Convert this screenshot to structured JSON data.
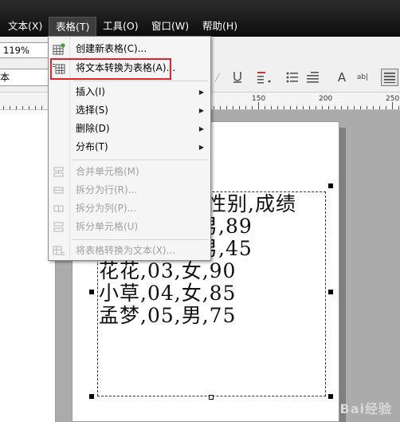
{
  "menubar": {
    "items": [
      {
        "label": "文本(X)"
      },
      {
        "label": "表格(T)"
      },
      {
        "label": "工具(O)"
      },
      {
        "label": "窗口(W)"
      },
      {
        "label": "帮助(H)"
      }
    ]
  },
  "toolbar": {
    "zoom_value": "119%",
    "font_value": "本",
    "icons": [
      "underline-icon",
      "bullets-icon",
      "list-icon",
      "align-icon",
      "text-icon",
      "font-icon",
      "paragraph-icon"
    ]
  },
  "ruler": {
    "labels": [
      "150",
      "200",
      "250"
    ]
  },
  "table_menu": {
    "items": [
      {
        "label": "创建新表格(C)...",
        "icon": "table-new-icon",
        "enabled": true
      },
      {
        "label": "将文本转换为表格(A)...",
        "icon": "table-convert-icon",
        "enabled": true
      },
      {
        "label": "插入(I)",
        "submenu": true,
        "enabled": true
      },
      {
        "label": "选择(S)",
        "submenu": true,
        "enabled": true
      },
      {
        "label": "删除(D)",
        "submenu": true,
        "enabled": true
      },
      {
        "label": "分布(T)",
        "submenu": true,
        "enabled": true
      },
      {
        "label": "合并单元格(M)",
        "enabled": false
      },
      {
        "label": "拆分为行(R)...",
        "enabled": false
      },
      {
        "label": "拆分为列(P)...",
        "enabled": false
      },
      {
        "label": "拆分单元格(U)",
        "enabled": false
      },
      {
        "label": "将表格转换为文本(X)...",
        "enabled": false
      }
    ]
  },
  "document": {
    "lines": [
      "性别,成绩",
      "男,89",
      "男,45",
      "花花,03,女,90",
      "小草,04,女,85",
      "孟梦,05,男,75"
    ]
  },
  "watermark": "Bai经验",
  "colors": {
    "highlight": "#e0242a",
    "menubar": "#1a1a1a"
  }
}
